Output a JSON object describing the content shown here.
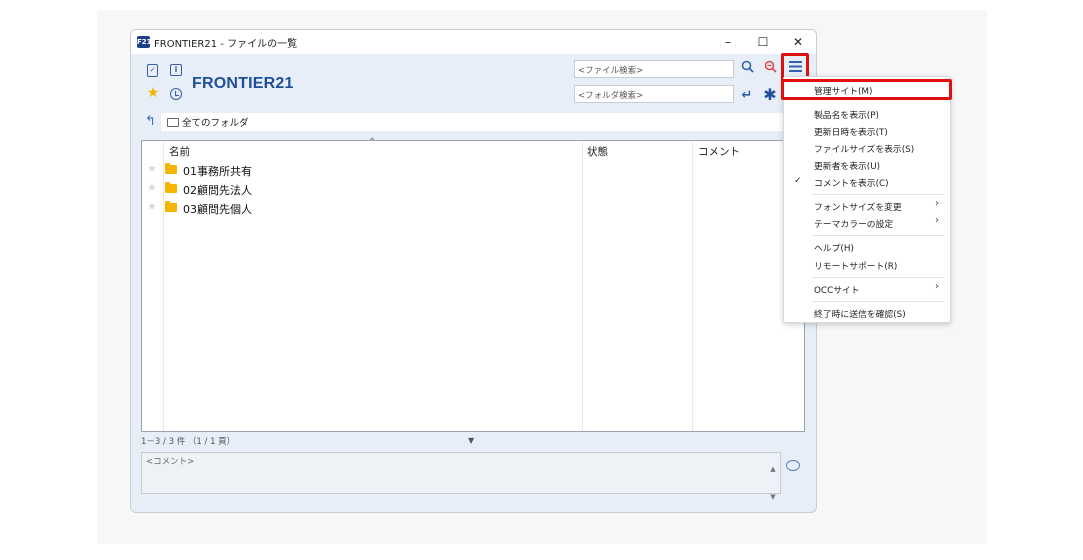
{
  "window": {
    "app_icon_label": "F21",
    "title": "FRONTIER21 - ファイルの一覧",
    "minimize": "–",
    "maximize": "☐",
    "close": "✕"
  },
  "header": {
    "brand": "FRONTIER21",
    "file_search_placeholder": "<ファイル検索>",
    "folder_search_placeholder": "<フォルダ検索>"
  },
  "path": {
    "current": "全てのフォルダ"
  },
  "list": {
    "columns": [
      "名前",
      "状態",
      "コメント"
    ],
    "rows": [
      {
        "name": "01事務所共有"
      },
      {
        "name": "02顧問先法人"
      },
      {
        "name": "03顧問先個人"
      }
    ]
  },
  "status": {
    "count": "1－3 / 3 件 （1 / 1 頁）",
    "comment_placeholder": "<コメント>"
  },
  "menu": {
    "items": [
      {
        "label": "管理サイト(M)"
      },
      {
        "label": "製品名を表示(P)"
      },
      {
        "label": "更新日時を表示(T)"
      },
      {
        "label": "ファイルサイズを表示(S)"
      },
      {
        "label": "更新者を表示(U)"
      },
      {
        "label": "コメントを表示(C)",
        "checked": true
      },
      {
        "label": "フォントサイズを変更",
        "submenu": true
      },
      {
        "label": "テーマカラーの設定",
        "submenu": true
      },
      {
        "label": "ヘルプ(H)"
      },
      {
        "label": "リモートサポート(R)"
      },
      {
        "label": "OCCサイト",
        "submenu": true
      },
      {
        "label": "終了時に送信を確認(S)"
      }
    ],
    "check_glyph": "✓",
    "submenu_glyph": "›"
  },
  "colors": {
    "accent": "#1e4f98",
    "highlight": "#e01010",
    "folder": "#f3b500",
    "favorite": "#f0b400"
  }
}
